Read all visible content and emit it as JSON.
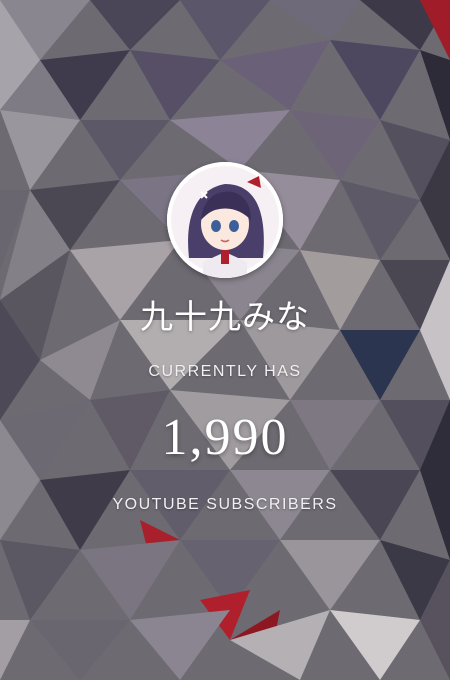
{
  "channel": {
    "name": "九十九みな",
    "avatar_icon": "vtuber-avatar-icon"
  },
  "stats": {
    "prefix_label": "CURRENTLY HAS",
    "subscriber_count": "1,990",
    "suffix_label": "YOUTUBE SUBSCRIBERS"
  },
  "theme": {
    "text_color": "#ffffff",
    "background_base": "#6e6a72",
    "accent_red": "#b0202c"
  }
}
